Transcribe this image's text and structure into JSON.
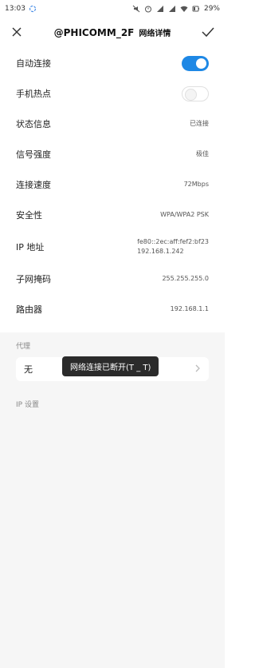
{
  "status_bar": {
    "time": "13:03",
    "battery": "29%"
  },
  "header": {
    "ssid": "@PHICOMM_2F",
    "subtitle": "网络详情"
  },
  "rows": {
    "auto_connect": {
      "label": "自动连接",
      "state": "on"
    },
    "hotspot": {
      "label": "手机热点",
      "state": "off"
    },
    "status": {
      "label": "状态信息",
      "value": "已连接"
    },
    "signal": {
      "label": "信号强度",
      "value": "极佳"
    },
    "speed": {
      "label": "连接速度",
      "value": "72Mbps"
    },
    "security": {
      "label": "安全性",
      "value": "WPA/WPA2 PSK"
    },
    "ip": {
      "label": "IP 地址",
      "value_line1": "fe80::2ec:aff:fef2:bf23",
      "value_line2": "192.168.1.242"
    },
    "subnet": {
      "label": "子网掩码",
      "value": "255.255.255.0"
    },
    "router": {
      "label": "路由器",
      "value": "192.168.1.1"
    }
  },
  "proxy": {
    "section_label": "代理",
    "value": "无"
  },
  "ip_settings": {
    "section_label": "IP 设置"
  },
  "toast": {
    "text": "网络连接已断开(T _ T)"
  },
  "colors": {
    "toggle_on": "#1e88e5",
    "background": "#ffffff",
    "section_bg": "#f6f6f6"
  }
}
